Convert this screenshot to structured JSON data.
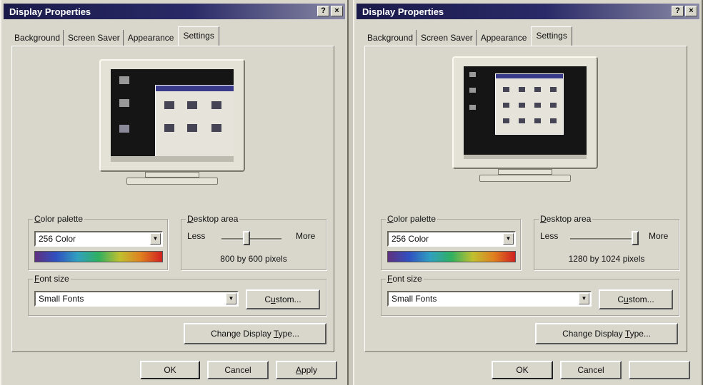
{
  "left": {
    "title": "Display Properties",
    "help_label": "?",
    "close_label": "×",
    "tabs": [
      "Background",
      "Screen Saver",
      "Appearance",
      "Settings"
    ],
    "active_tab": "Settings",
    "color_palette": {
      "label_prefix": "C",
      "label_rest": "olor palette",
      "value": "256 Color"
    },
    "desktop_area": {
      "label_prefix": "D",
      "label_rest": "esktop area",
      "less": "Less",
      "more": "More",
      "value": "800 by 600 pixels",
      "slider_position": 0.35
    },
    "font_size": {
      "label_prefix": "F",
      "label_rest": "ont size",
      "value": "Small Fonts"
    },
    "custom_button": {
      "pre": "C",
      "u": "u",
      "post": "stom..."
    },
    "change_display_button": {
      "pre": "Change Display ",
      "u": "T",
      "post": "ype..."
    },
    "ok": "OK",
    "cancel": "Cancel",
    "apply": {
      "u": "A",
      "post": "pply"
    }
  },
  "right": {
    "title": "Display Properties",
    "help_label": "?",
    "close_label": "×",
    "tabs": [
      "Background",
      "Screen Saver",
      "Appearance",
      "Settings"
    ],
    "active_tab": "Settings",
    "color_palette": {
      "label_prefix": "C",
      "label_rest": "olor palette",
      "value": "256 Color"
    },
    "desktop_area": {
      "label_prefix": "D",
      "label_rest": "esktop area",
      "less": "Less",
      "more": "More",
      "value": "1280 by 1024 pixels",
      "slider_position": 0.95
    },
    "font_size": {
      "label_prefix": "F",
      "label_rest": "ont size",
      "value": "Small Fonts"
    },
    "custom_button": {
      "pre": "C",
      "u": "u",
      "post": "stom..."
    },
    "change_display_button": {
      "pre": "Change Display ",
      "u": "T",
      "post": "ype..."
    },
    "ok": "OK",
    "cancel": "Cancel"
  }
}
